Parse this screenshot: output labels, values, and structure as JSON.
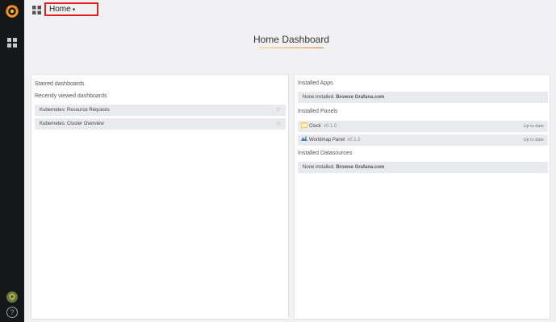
{
  "topbar": {
    "home_label": "Home",
    "caret": "▾"
  },
  "dashboard": {
    "title": "Home Dashboard"
  },
  "left": {
    "starred_heading": "Starred dashboards",
    "recent_heading": "Recently viewed dashboards",
    "recent": [
      {
        "label": "Kubernetes: Resource Requests"
      },
      {
        "label": "Kubernetes: Cluster Overview"
      }
    ],
    "star_glyph": "☆"
  },
  "right": {
    "apps_heading": "Installed Apps",
    "apps_none_prefix": "None installed.",
    "apps_none_link": "Browse Grafana.com",
    "panels_heading": "Installed Panels",
    "panels": [
      {
        "name": "Clock",
        "version": "v0.1.0",
        "status": "Up to date",
        "icon": "clock-panel-icon"
      },
      {
        "name": "Worldmap Panel",
        "version": "v0.1.2",
        "status": "Up to date",
        "icon": "worldmap-panel-icon"
      }
    ],
    "datasources_heading": "Installed Datasources",
    "ds_none_prefix": "None installed.",
    "ds_none_link": "Browse Grafana.com"
  },
  "sidebar": {
    "help_glyph": "?"
  },
  "colors": {
    "sidebar": "#161719",
    "accent_red": "#e02020",
    "logo_orange": "#f79520"
  }
}
